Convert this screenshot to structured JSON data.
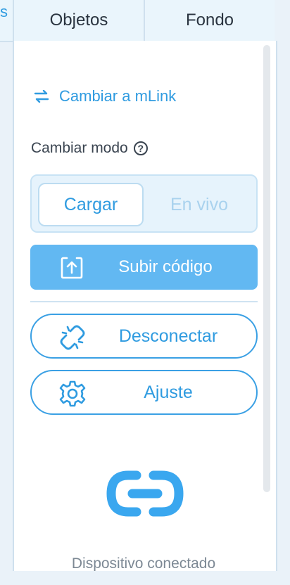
{
  "tabs": {
    "partial_label": "s",
    "items": [
      {
        "label": "Objetos"
      },
      {
        "label": "Fondo"
      }
    ]
  },
  "panel": {
    "switch_link": {
      "label": "Cambiar a mLink",
      "icon": "swap-arrows-icon"
    },
    "mode": {
      "label": "Cambiar modo",
      "help_icon": "question-circle-icon",
      "options": [
        {
          "label": "Cargar",
          "selected": true
        },
        {
          "label": "En vivo",
          "selected": false
        }
      ]
    },
    "upload_button": {
      "label": "Subir código",
      "icon": "upload-icon"
    },
    "disconnect_button": {
      "label": "Desconectar",
      "icon": "broken-link-icon"
    },
    "settings_button": {
      "label": "Ajuste",
      "icon": "gear-icon"
    },
    "status": {
      "icon": "link-icon",
      "text": "Dispositivo conectado"
    }
  },
  "colors": {
    "accent": "#2f9be0",
    "primary_button": "#62b8f2",
    "background": "#eaf2f9"
  }
}
